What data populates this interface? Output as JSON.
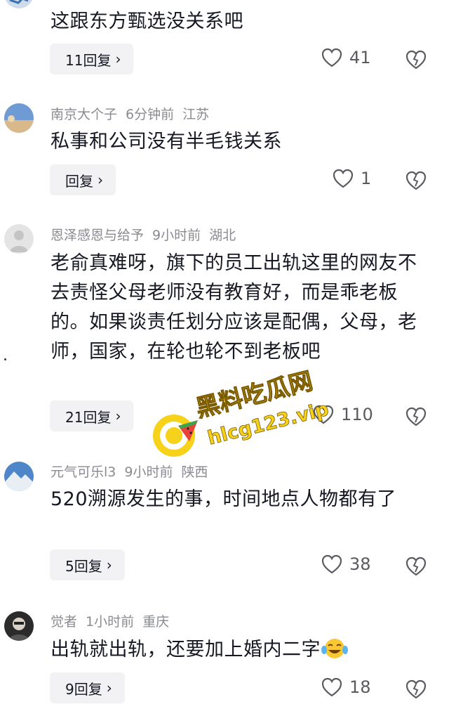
{
  "comments": [
    {
      "text": "这跟东方甄选没关系吧",
      "reply_label": "11回复",
      "likes": "41"
    },
    {
      "user": "南京大个子",
      "time": "6分钟前",
      "location": "江苏",
      "text": "私事和公司没有半毛钱关系",
      "reply_label": "回复",
      "likes": "1"
    },
    {
      "user": "恩泽感恩与给予",
      "time": "9小时前",
      "location": "湖北",
      "text": "老俞真难呀，旗下的员工出轨这里的网友不去责怪父母老师没有教育好，而是乖老板的。如果谈责任划分应该是配偶，父母，老师，国家，在轮也轮不到老板吧",
      "reply_label": "21回复",
      "likes": "110"
    },
    {
      "user": "元气可乐l3",
      "time": "9小时前",
      "location": "陕西",
      "text": "520溯源发生的事，时间地点人物都有了",
      "reply_label": "5回复",
      "likes": "38"
    },
    {
      "user": "觉者",
      "time": "1小时前",
      "location": "重庆",
      "text": "出轨就出轨，还要加上婚内二字",
      "reply_label": "9回复",
      "likes": "18"
    }
  ],
  "watermark": {
    "line1": "黑料吃瓜网",
    "line2": "hlcg123.vip"
  },
  "icons": {
    "reply_chevron": "chevron-right-icon",
    "like": "heart-outline-icon",
    "dislike": "broken-heart-icon",
    "emoji": "tears-of-joy-emoji"
  },
  "colors": {
    "meta": "#8a8b91",
    "reply_bg": "#f2f2f4",
    "watermark_yellow": "#f7d21a"
  }
}
